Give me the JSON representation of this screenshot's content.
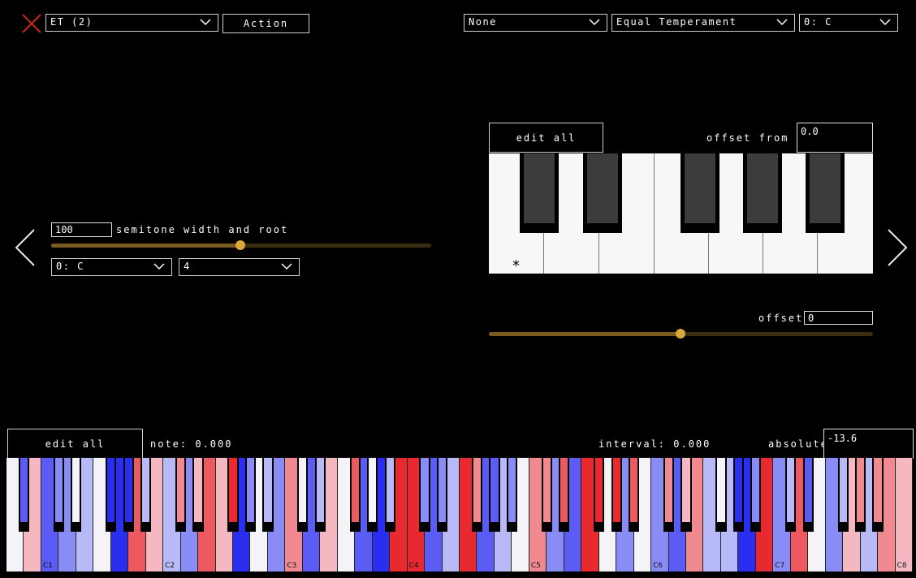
{
  "header": {
    "preset_select": "ET (2)",
    "action_label": "Action",
    "select_a": "None",
    "select_b": "Equal Temperament",
    "select_c": "0: C"
  },
  "left_panel": {
    "semitone_value": "100",
    "semitone_label": "semitone width and root",
    "semitone_slider_fraction": 0.5,
    "root_select": "0: C",
    "octave_select": "4"
  },
  "right_panel": {
    "edit_all_label": "edit all",
    "offset_from_et_label": "offset from ET",
    "offset_from_et_value": "0.0",
    "root_marker": "*",
    "offset_label": "offset:",
    "offset_value": "0",
    "offset_slider_fraction": 0.5
  },
  "bottom": {
    "edit_all_label": "edit all",
    "note_label": "note: 0.000",
    "interval_label": "interval: 0.000",
    "absolute_label": "absolute",
    "absolute_value": "-13.6",
    "octave_labels": [
      "C1",
      "C2",
      "C3",
      "C4",
      "C5",
      "C6",
      "C7",
      "C8"
    ]
  },
  "colors": {
    "accent": "#d8a83a",
    "slider_track": "#3a2c10",
    "close_icon": "#c4261c"
  },
  "icons": {
    "close": "close-x-icon",
    "prev": "chevron-left-icon",
    "next": "chevron-right-icon",
    "dropdown": "chevron-down-icon"
  }
}
